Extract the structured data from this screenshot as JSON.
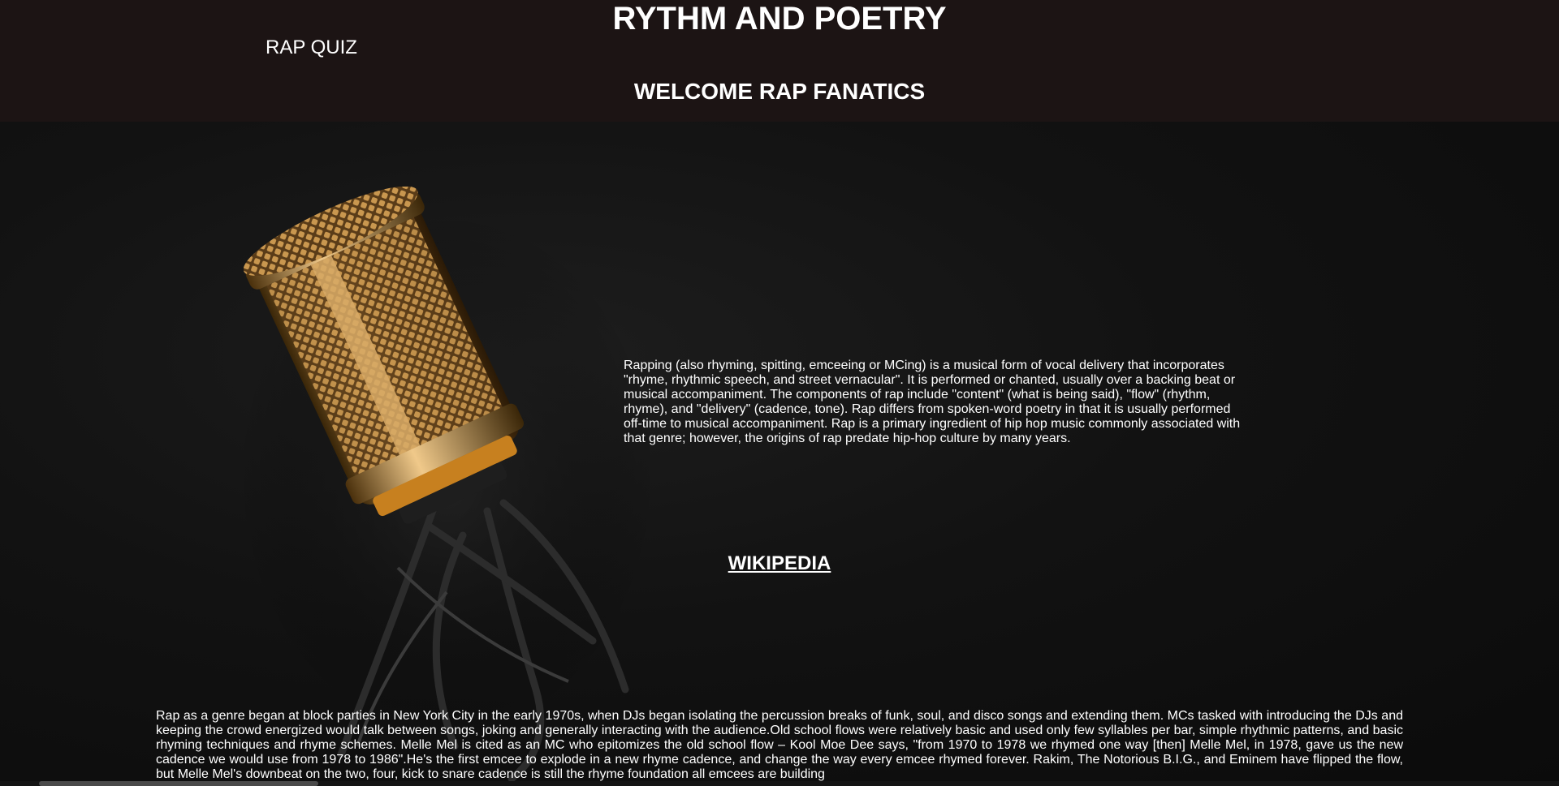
{
  "header": {
    "title": "RYTHM AND POETRY",
    "nav_link": "RAP QUIZ",
    "welcome": "WELCOME RAP FANATICS"
  },
  "hero": {
    "image_subject": "microphone-image",
    "intro": "Rapping (also rhyming, spitting, emceeing or MCing) is a musical form of vocal delivery that incorporates \"rhyme, rhythmic speech, and street vernacular\". It is performed or chanted, usually over a backing beat or musical accompaniment. The components of rap include \"content\" (what is being said), \"flow\" (rhythm, rhyme), and \"delivery\" (cadence, tone). Rap differs from spoken-word poetry in that it is usually performed off-time to musical accompaniment. Rap is a primary ingredient of hip hop music commonly associated with that genre; however, the origins of rap predate hip-hop culture by many years."
  },
  "wiki_link": "WIKIPEDIA",
  "history": {
    "text": "Rap as a genre began at block parties in New York City in the early 1970s, when DJs began isolating the percussion breaks of funk, soul, and disco songs and extending them. MCs tasked with introducing the DJs and keeping the crowd energized would talk between songs, joking and generally interacting with the audience.Old school flows were relatively basic and used only few syllables per bar, simple rhythmic patterns, and basic rhyming techniques and rhyme schemes. Melle Mel is cited as an MC who epitomizes the old school flow – Kool Moe Dee says, \"from 1970 to 1978 we rhymed one way [then] Melle Mel, in 1978, gave us the new cadence we would use from 1978 to 1986\".He's the first emcee to explode in a new rhyme cadence, and change the way every emcee rhymed forever. Rakim, The Notorious B.I.G., and Eminem have flipped the flow, but Melle Mel's downbeat on the two, four, kick to snare cadence is still the rhyme foundation all emcees are building"
  },
  "colors": {
    "header_bg": "#1c1414",
    "page_bg": "#0e0e0e",
    "text": "#ffffff",
    "mic_gold": "#b8884a"
  }
}
